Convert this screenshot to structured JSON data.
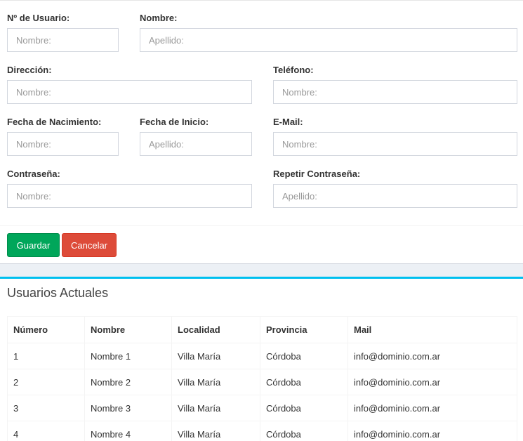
{
  "form": {
    "fields": {
      "nro_usuario": {
        "label": "Nº de Usuario:",
        "placeholder": "Nombre:",
        "value": ""
      },
      "nombre": {
        "label": "Nombre:",
        "placeholder": "Apellido:",
        "value": ""
      },
      "direccion": {
        "label": "Dirección:",
        "placeholder": "Nombre:",
        "value": ""
      },
      "telefono": {
        "label": "Teléfono:",
        "placeholder": "Nombre:",
        "value": ""
      },
      "fecha_nacimiento": {
        "label": "Fecha de Nacimiento:",
        "placeholder": "Nombre:",
        "value": ""
      },
      "fecha_inicio": {
        "label": "Fecha de Inicio:",
        "placeholder": "Apellido:",
        "value": ""
      },
      "email": {
        "label": "E-Mail:",
        "placeholder": "Nombre:",
        "value": ""
      },
      "contrasena": {
        "label": "Contraseña:",
        "placeholder": "Nombre:",
        "value": ""
      },
      "repetir_contrasena": {
        "label": "Repetir Contraseña:",
        "placeholder": "Apellido:",
        "value": ""
      }
    },
    "buttons": {
      "save_label": "Guardar",
      "cancel_label": "Cancelar"
    }
  },
  "users_table": {
    "title": "Usuarios Actuales",
    "headers": [
      "Número",
      "Nombre",
      "Localidad",
      "Provincia",
      "Mail"
    ],
    "rows": [
      [
        "1",
        "Nombre 1",
        "Villa María",
        "Córdoba",
        "info@dominio.com.ar"
      ],
      [
        "2",
        "Nombre 2",
        "Villa María",
        "Córdoba",
        "info@dominio.com.ar"
      ],
      [
        "3",
        "Nombre 3",
        "Villa María",
        "Córdoba",
        "info@dominio.com.ar"
      ],
      [
        "4",
        "Nombre 4",
        "Villa María",
        "Córdoba",
        "info@dominio.com.ar"
      ]
    ]
  },
  "colors": {
    "success": "#00a65a",
    "danger": "#dd4b39",
    "box_accent": "#00c0ef",
    "page_background": "#ecf0f5"
  }
}
